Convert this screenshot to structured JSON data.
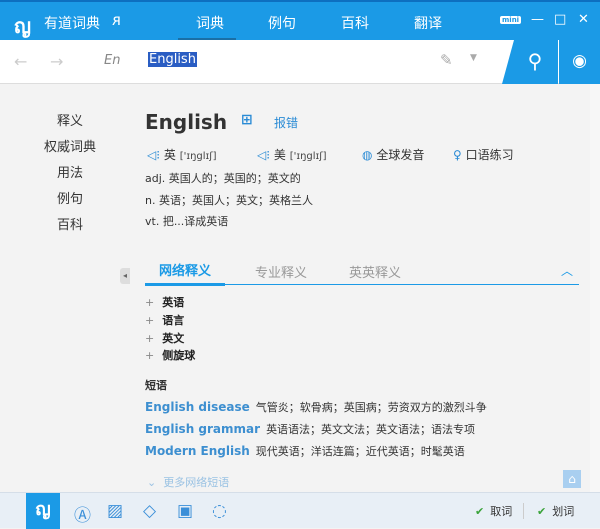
{
  "app": {
    "logo": "81",
    "name": "有道词典",
    "user_icon": "user-icon"
  },
  "nav": [
    "词典",
    "例句",
    "百科",
    "翻译"
  ],
  "window": {
    "mini": "mini",
    "minimize": "—",
    "maximize": "□",
    "close": "✕"
  },
  "search": {
    "back": "←",
    "forward": "→",
    "lang": "En",
    "query": "English",
    "pen": "✎",
    "dropdown": "▼",
    "search_icon": "⚲",
    "globe_icon": "◍"
  },
  "sidebar": [
    "释义",
    "权威词典",
    "用法",
    "例句",
    "百科"
  ],
  "entry": {
    "word": "English",
    "add_icon": "⊞",
    "report": "报错",
    "uk_label": "英",
    "uk_phon": "['ɪŋglɪʃ]",
    "us_label": "美",
    "us_phon": "['ɪŋglɪʃ]",
    "global": "全球发音",
    "oral": "口语练习",
    "defs": [
      "adj. 英国人的；英国的；英文的",
      "n. 英语；英国人；英文；英格兰人",
      "vt. 把...译成英语"
    ]
  },
  "tabs": [
    "网络释义",
    "专业释义",
    "英英释义"
  ],
  "web_defs": [
    "英语",
    "语言",
    "英文",
    "侧旋球"
  ],
  "phrases": {
    "title": "短语",
    "items": [
      {
        "en": "English disease",
        "cn": "气管炎；软骨病；英国病；劳资双方的激烈斗争"
      },
      {
        "en": "English grammar",
        "cn": "英语语法；英文文法；英文语法；语法专项"
      },
      {
        "en": "Modern English",
        "cn": "现代英语；洋话连篇；近代英语；时髦英语"
      }
    ],
    "more": "更多网络短语"
  },
  "bottom": {
    "take_word": "取词",
    "select_word": "划词"
  },
  "colors": {
    "accent": "#1b9ae6",
    "link": "#2a8bd5"
  }
}
